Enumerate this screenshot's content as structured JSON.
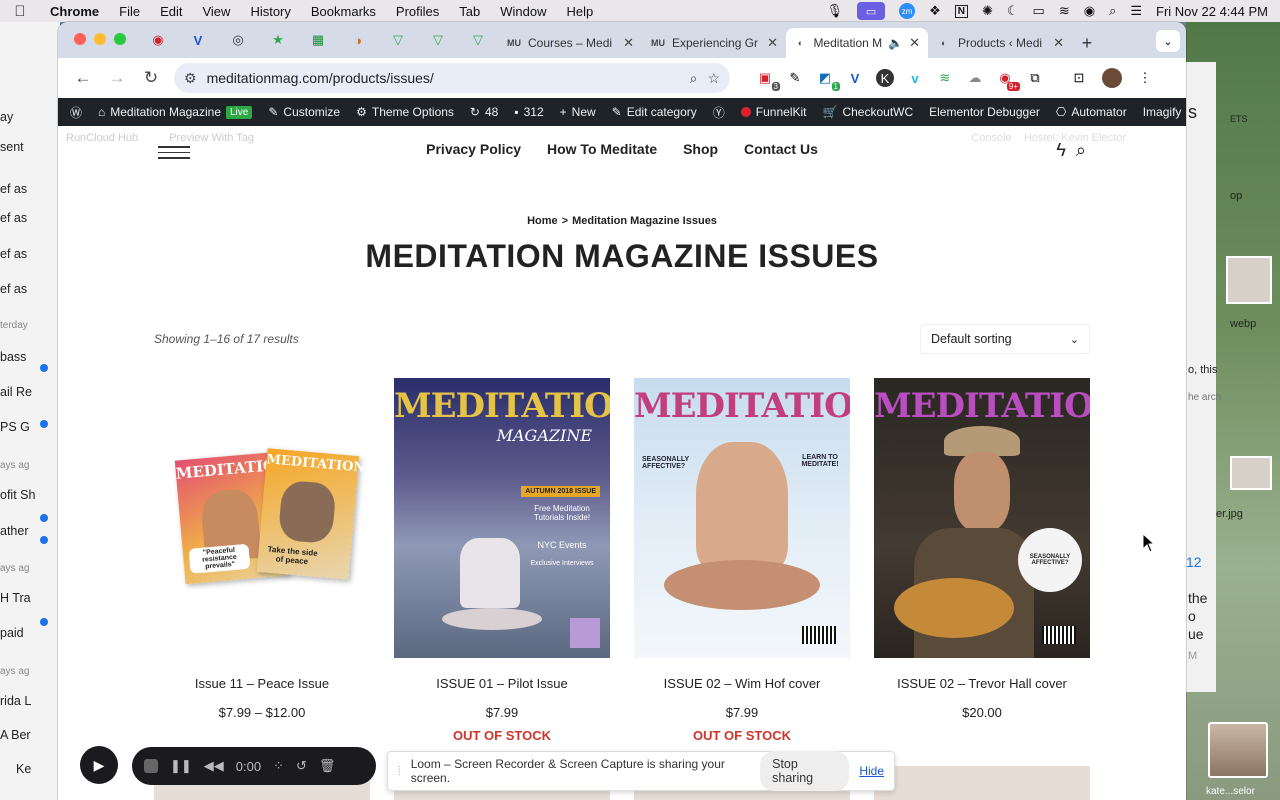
{
  "menubar": {
    "app": "Chrome",
    "items": [
      "File",
      "Edit",
      "View",
      "History",
      "Bookmarks",
      "Profiles",
      "Tab",
      "Window",
      "Help"
    ],
    "clock": "Fri Nov 22  4:44 PM"
  },
  "tabs": [
    {
      "label": "Courses – Medi",
      "fav": "MU"
    },
    {
      "label": "Experiencing Gr",
      "fav": "MU"
    },
    {
      "label": "Meditation M",
      "fav": "◐",
      "active": true
    },
    {
      "label": "Products ‹ Medi",
      "fav": "◐"
    }
  ],
  "omnibox": {
    "url": "meditationmag.com/products/issues/"
  },
  "extensions": {
    "badge1": "3",
    "badge2": "1",
    "badge3": "9+"
  },
  "wpbar": {
    "site": "Meditation Magazine",
    "live": "Live",
    "customize": "Customize",
    "theme_options": "Theme Options",
    "updates": "48",
    "comments": "312",
    "new": "New",
    "edit_category": "Edit category",
    "funnelkit": "FunnelKit",
    "checkout": "CheckoutWC",
    "elementor": "Elementor Debugger",
    "automator": "Automator",
    "imagify": "Imagify"
  },
  "ghost": {
    "a": "RunCloud Hub",
    "b": "Preview With Tag",
    "c": "Console",
    "d": "Hostel: Kevin Elector"
  },
  "nav": {
    "items": [
      "Privacy Policy",
      "How To Meditate",
      "Shop",
      "Contact Us"
    ]
  },
  "breadcrumb": {
    "home": "Home",
    "sep": ">",
    "current": "Meditation Magazine Issues"
  },
  "page_title": "MEDITATION MAGAZINE ISSUES",
  "results": "Showing 1–16 of 17 results",
  "sort": {
    "selected": "Default sorting"
  },
  "products": [
    {
      "name": "Issue 11 – Peace Issue",
      "price": "$7.99 – $12.00",
      "stock": ""
    },
    {
      "name": "ISSUE 01 – Pilot Issue",
      "price": "$7.99",
      "stock": "OUT OF STOCK"
    },
    {
      "name": "ISSUE 02 – Wim Hof cover",
      "price": "$7.99",
      "stock": "OUT OF STOCK"
    },
    {
      "name": "ISSUE 02 – Trevor Hall cover",
      "price": "$20.00",
      "stock": ""
    }
  ],
  "covers": {
    "title_a": "MEDITATION",
    "sub_a": "MAGAZINE",
    "autumn": "AUTUMN 2018 ISSUE",
    "free": "Free Meditation Tutorials Inside!",
    "nyc": "NYC Events",
    "interviews": "Exclusive Interviews",
    "seasonal": "SEASONALLY AFFECTIVE?",
    "learn": "LEARN TO MEDITATE!",
    "peace": "\"Peaceful resistance prevails\"",
    "take": "Take the side of peace"
  },
  "loom": {
    "time": "0:00",
    "message": "Loom – Screen Recorder & Screen Capture is sharing your screen.",
    "stop": "Stop sharing",
    "hide": "Hide"
  },
  "bgapp": {
    "rows": [
      "ay",
      "sent",
      "ef as",
      "ef as",
      "ef as",
      "ef as",
      "terday",
      "bass",
      "ail Re",
      "PS G",
      "ays ag",
      "ofit Sh",
      "ather",
      "ays ag",
      "H Tra",
      "paid",
      "ays ag",
      "rida L",
      "A Ber",
      "Ke"
    ]
  },
  "bgright": {
    "t1": "s",
    "t2": "ETS",
    "t3": "op",
    "t4": "webp",
    "t5": "o, this",
    "t6": "he arch",
    "t7": "er.jpg",
    "t8": "12",
    "t9": "the",
    "t10": "o",
    "t11": "ue",
    "t12": "M"
  },
  "pip": {
    "name": "kate...selor"
  },
  "colors": {
    "accent": "#1a73e8",
    "wpbar": "#1d2327",
    "outofstock": "#d0342c",
    "live": "#2ea745"
  }
}
